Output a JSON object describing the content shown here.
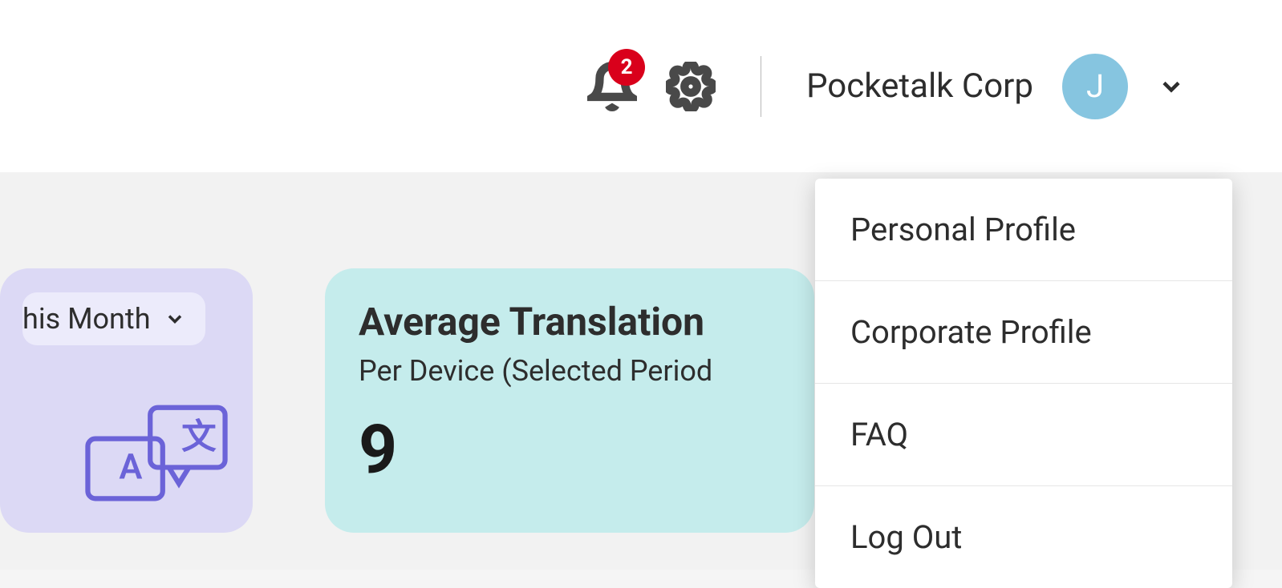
{
  "header": {
    "notification_count": "2",
    "org_name": "Pocketalk Corp",
    "avatar_initial": "J"
  },
  "cards": {
    "period_label": "his Month",
    "avg_translation": {
      "title": "Average Translation",
      "subtitle": "Per Device (Selected Period",
      "value": "9"
    }
  },
  "user_menu": {
    "items": [
      "Personal Profile",
      "Corporate Profile",
      "FAQ",
      "Log Out"
    ]
  }
}
